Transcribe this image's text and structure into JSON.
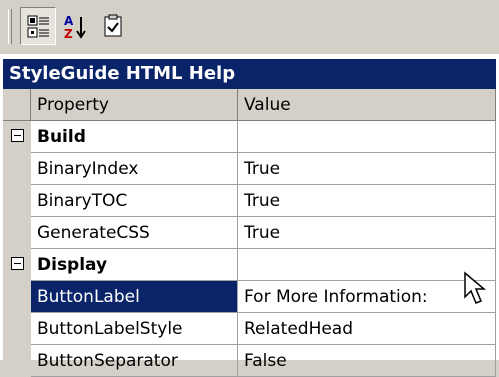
{
  "toolbar": {
    "buttons": [
      {
        "name": "categorized",
        "icon": "categorized-icon"
      },
      {
        "name": "alphabetical",
        "icon": "sort-az-icon"
      },
      {
        "name": "property-pages",
        "icon": "property-pages-icon"
      }
    ]
  },
  "object_title": "StyleGuide HTML Help",
  "columns": {
    "property": "Property",
    "value": "Value"
  },
  "categories": [
    {
      "label": "Build",
      "rows": [
        {
          "property": "BinaryIndex",
          "value": "True"
        },
        {
          "property": "BinaryTOC",
          "value": "True"
        },
        {
          "property": "GenerateCSS",
          "value": "True"
        }
      ]
    },
    {
      "label": "Display",
      "rows": [
        {
          "property": "ButtonLabel",
          "value": "For More Information:"
        },
        {
          "property": "ButtonLabelStyle",
          "value": "RelatedHead"
        },
        {
          "property": "ButtonSeparator",
          "value": "False"
        }
      ]
    }
  ],
  "selected_property": "ButtonLabel",
  "colors": {
    "selection": "#0a246a",
    "face": "#d4d0c8"
  }
}
